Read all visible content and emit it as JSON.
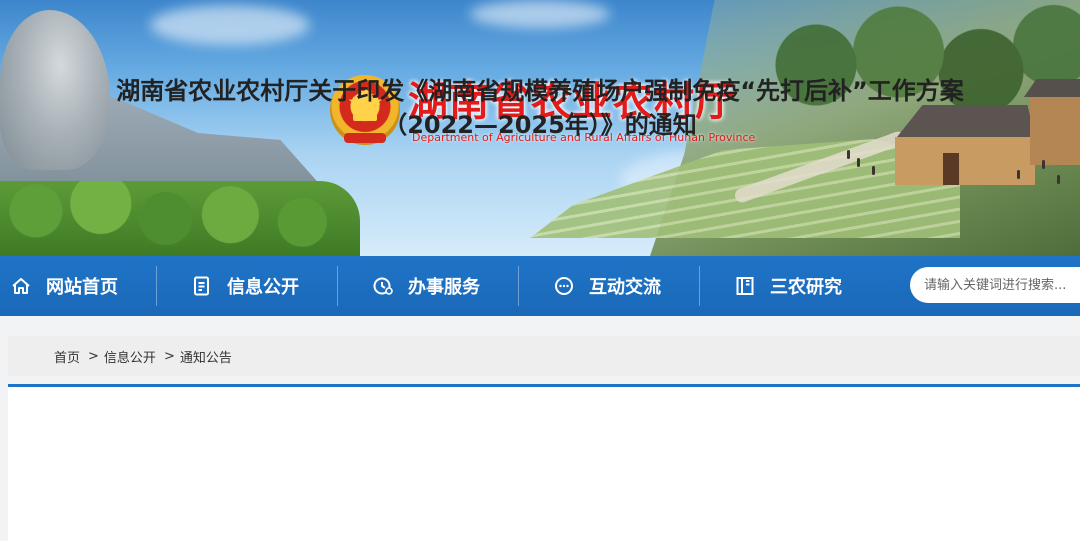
{
  "header": {
    "title": "湖南省农业农村厅",
    "subtitle": "Department of Agriculture and Rural Affairs of Hunan Province",
    "emblem": "national-emblem"
  },
  "nav": {
    "items": [
      {
        "label": "网站首页",
        "icon": "home-icon"
      },
      {
        "label": "信息公开",
        "icon": "document-icon"
      },
      {
        "label": "办事服务",
        "icon": "service-icon"
      },
      {
        "label": "互动交流",
        "icon": "chat-icon"
      },
      {
        "label": "三农研究",
        "icon": "book-icon"
      }
    ],
    "search_placeholder": "请输入关键词进行搜索..."
  },
  "breadcrumb": {
    "items": [
      "首页",
      "信息公开",
      "通知公告"
    ],
    "separator": ">"
  },
  "article": {
    "title_line1": "湖南省农业农村厅关于印发《湖南省规模养殖场户强制免疫“先打后补”工作方案",
    "title_line2": "（2022—2025年）》的通知"
  },
  "colors": {
    "nav_blue": "#1f74c7",
    "title_red": "#e21b1b"
  }
}
